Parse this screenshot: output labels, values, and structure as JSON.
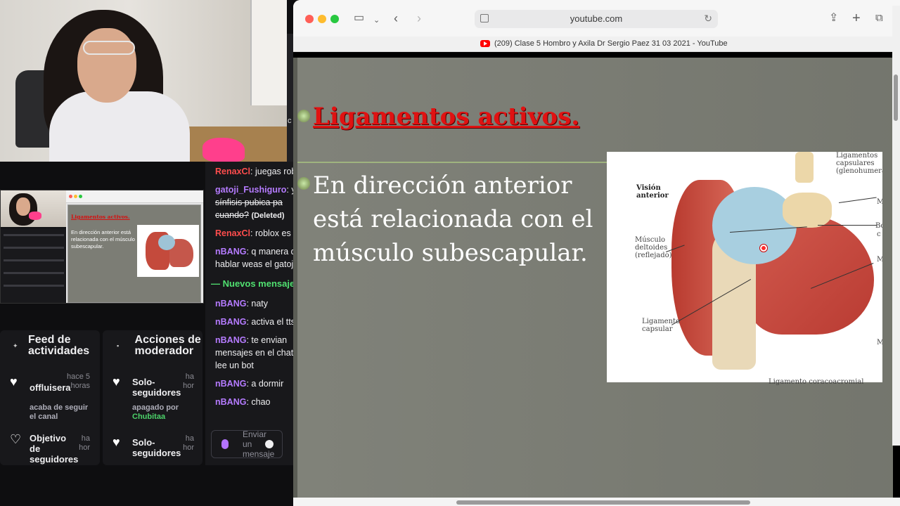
{
  "browser": {
    "address": "youtube.com",
    "tab_title": "(209) Clase 5 Hombro y Axila Dr Sergio Paez 31 03 2021 - YouTube"
  },
  "slide": {
    "title": "Ligamentos activos.",
    "body": "En dirección anterior está relacionada con el músculo subescapular.",
    "figure_labels": {
      "view": "Visión anterior",
      "capsular_ligaments": "Ligamentos capsulares (glenohumerales",
      "deltoid": "Músculo deltoides (reflejado)",
      "capsular_ligament": "Ligamento capsular",
      "coracoacromial": "Ligamento coracoacromial",
      "m1": "M",
      "bo": "Bo",
      "c": "c",
      "m2": "M",
      "m3": "M"
    }
  },
  "mini_preview": {
    "slide_title": "Ligamentos activos.",
    "slide_body": "En dirección anterior está relacionada con el músculo subescapular."
  },
  "feed_panel": {
    "title": "Feed de actividades",
    "items": [
      {
        "name": "offluisera",
        "time": "hace 5 horas",
        "subtitle": "acaba de seguir el canal"
      },
      {
        "name": "Objetivo de seguidores",
        "time": "ha hor",
        "subtitle": ""
      }
    ]
  },
  "mod_panel": {
    "title": "Acciones de moderador",
    "items": [
      {
        "name": "Solo-seguidores",
        "time": "ha hor",
        "subtitle": "apagado por",
        "actor": "Chubitaa"
      },
      {
        "name": "Solo-seguidores",
        "time": "ha hor",
        "subtitle": "",
        "actor": ""
      }
    ]
  },
  "chat": {
    "messages": [
      {
        "user": "RenaxCl",
        "color": "#ff4d4d",
        "text": ": juegas rob"
      },
      {
        "user": "gatoji_Fushiguro",
        "color": "#b57bff",
        "text": ": y"
      },
      {
        "user": "",
        "color": "",
        "text": "sínfisis pubica pa"
      },
      {
        "user": "",
        "color": "",
        "text": "cuando?",
        "deleted": "(Deleted)"
      },
      {
        "user": "RenaxCl",
        "color": "#ff4d4d",
        "text": ": roblox es"
      },
      {
        "user": "nBANG",
        "color": "#b57bff",
        "text": ": q manera d"
      },
      {
        "user": "",
        "color": "",
        "text": "hablar weas el gatoj"
      },
      {
        "user": "nBANG",
        "color": "#b57bff",
        "text": ": naty"
      },
      {
        "user": "nBANG",
        "color": "#b57bff",
        "text": ": activa el tts"
      },
      {
        "user": "nBANG",
        "color": "#b57bff",
        "text": ": te envian"
      },
      {
        "user": "",
        "color": "",
        "text": "mensajes en el chat"
      },
      {
        "user": "",
        "color": "",
        "text": "lee un bot"
      },
      {
        "user": "nBANG",
        "color": "#b57bff",
        "text": ": a dormir"
      },
      {
        "user": "nBANG",
        "color": "#b57bff",
        "text": ": chao"
      }
    ],
    "new_messages": "— Nuevos mensaje",
    "input_placeholder": "Enviar un mensaje",
    "edge_letter": "c"
  },
  "colors": {
    "twitch_bg": "#18181b",
    "slide_bg": "#7b7d74",
    "slide_title": "#e01212",
    "green": "#4cd26a"
  }
}
